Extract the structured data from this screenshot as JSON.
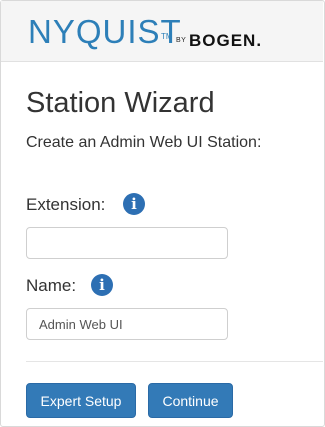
{
  "header": {
    "brand": "NYQUIST",
    "tm": "TM",
    "by": "BY",
    "partner": "BOGEN."
  },
  "wizard": {
    "title": "Station Wizard",
    "subtitle": "Create an Admin Web UI Station:"
  },
  "form": {
    "extension_label": "Extension:",
    "extension_value": "",
    "name_label": "Name:",
    "name_value": "Admin Web UI"
  },
  "icons": {
    "info_glyph": "i"
  },
  "buttons": {
    "expert_setup": "Expert Setup",
    "continue": "Continue"
  },
  "colors": {
    "brand_blue": "#2d7fb8",
    "button_blue": "#337ab7"
  }
}
